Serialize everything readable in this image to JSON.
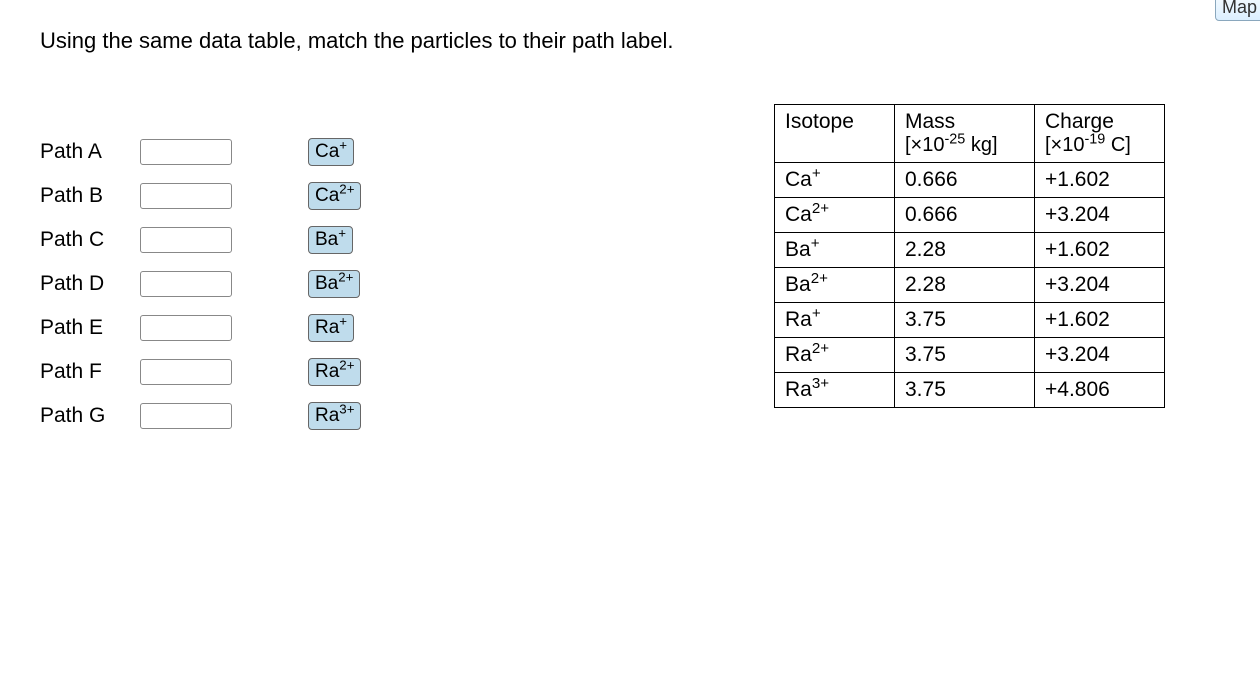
{
  "mapButton": "Map",
  "prompt": "Using the same data table, match the particles to their path label.",
  "paths": [
    {
      "label": "Path A"
    },
    {
      "label": "Path B"
    },
    {
      "label": "Path C"
    },
    {
      "label": "Path D"
    },
    {
      "label": "Path E"
    },
    {
      "label": "Path F"
    },
    {
      "label": "Path G"
    }
  ],
  "tokens": [
    {
      "base": "Ca",
      "sup": "+"
    },
    {
      "base": "Ca",
      "sup": "2+"
    },
    {
      "base": "Ba",
      "sup": "+"
    },
    {
      "base": "Ba",
      "sup": "2+"
    },
    {
      "base": "Ra",
      "sup": "+"
    },
    {
      "base": "Ra",
      "sup": "2+"
    },
    {
      "base": "Ra",
      "sup": "3+"
    }
  ],
  "table": {
    "headers": {
      "isotope": "Isotope",
      "mass_title": "Mass",
      "mass_unit_pre": "[×10",
      "mass_unit_exp": "-25",
      "mass_unit_post": " kg]",
      "charge_title": "Charge",
      "charge_unit_pre": "[×10",
      "charge_unit_exp": "-19",
      "charge_unit_post": " C]"
    },
    "rows": [
      {
        "base": "Ca",
        "sup": "+",
        "mass": "0.666",
        "charge": "+1.602"
      },
      {
        "base": "Ca",
        "sup": "2+",
        "mass": "0.666",
        "charge": "+3.204"
      },
      {
        "base": "Ba",
        "sup": "+",
        "mass": "2.28",
        "charge": "+1.602"
      },
      {
        "base": "Ba",
        "sup": "2+",
        "mass": "2.28",
        "charge": "+3.204"
      },
      {
        "base": "Ra",
        "sup": "+",
        "mass": "3.75",
        "charge": "+1.602"
      },
      {
        "base": "Ra",
        "sup": "2+",
        "mass": "3.75",
        "charge": "+3.204"
      },
      {
        "base": "Ra",
        "sup": "3+",
        "mass": "3.75",
        "charge": "+4.806"
      }
    ]
  }
}
